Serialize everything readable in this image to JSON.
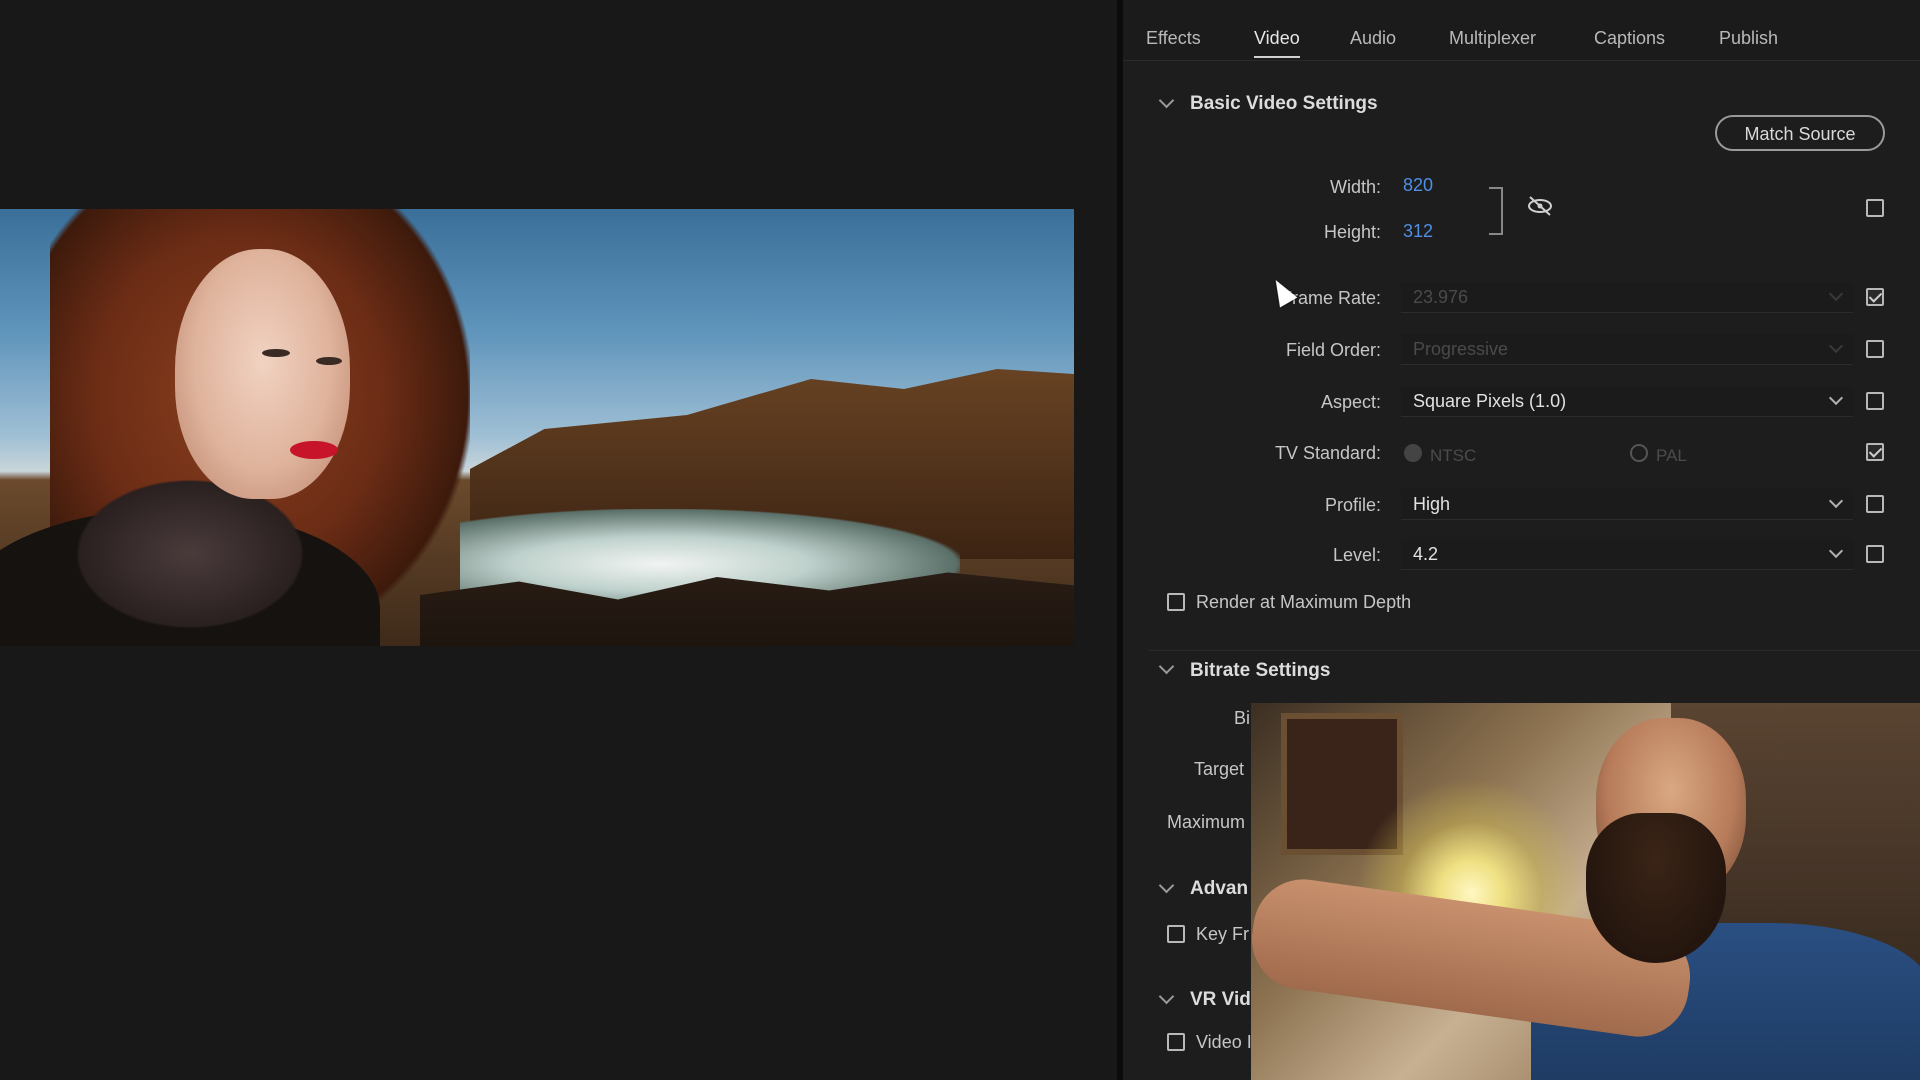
{
  "tabs": [
    "Effects",
    "Video",
    "Audio",
    "Multiplexer",
    "Captions",
    "Publish"
  ],
  "active_tab": "Video",
  "basic_video": {
    "title": "Basic Video Settings",
    "match_source": "Match Source",
    "width_label": "Width:",
    "width_value": "820",
    "height_label": "Height:",
    "height_value": "312",
    "frame_rate_label": "Frame Rate:",
    "frame_rate_value": "23.976",
    "field_order_label": "Field Order:",
    "field_order_value": "Progressive",
    "aspect_label": "Aspect:",
    "aspect_value": "Square Pixels (1.0)",
    "tv_standard_label": "TV Standard:",
    "tv_ntsc": "NTSC",
    "tv_pal": "PAL",
    "profile_label": "Profile:",
    "profile_value": "High",
    "level_label": "Level:",
    "level_value": "4.2",
    "render_max_depth": "Render at Maximum Depth",
    "checkboxes": {
      "dimensions": false,
      "frame_rate": true,
      "field_order": false,
      "aspect": false,
      "tv_standard": true,
      "profile": false,
      "level": false,
      "render_max_depth": false
    }
  },
  "bitrate": {
    "title": "Bitrate Settings",
    "row1": "Bi",
    "row2": "Target",
    "row3": "Maximum"
  },
  "advanced": {
    "title": "Advan",
    "key_frame": "Key Fr"
  },
  "vr": {
    "title": "VR Vid",
    "video_checkbox": "Video I"
  },
  "colors": {
    "accent_value": "#4f8fe6",
    "panel_bg": "#1d1d1d",
    "app_bg": "#181818"
  },
  "icons": {
    "link": "unlinked-chain-icon",
    "section_toggle": "chevron-down-icon"
  }
}
